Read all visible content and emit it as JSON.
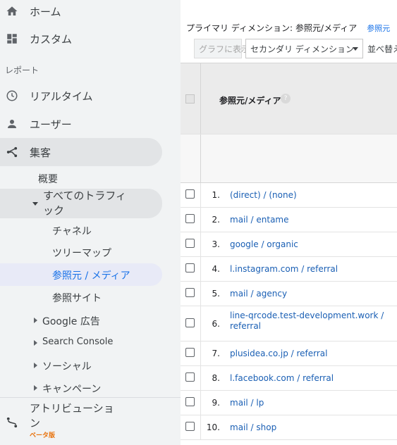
{
  "sidebar": {
    "top_items": [
      {
        "label": "ホーム",
        "icon": "home-icon"
      },
      {
        "label": "カスタム",
        "icon": "dashboard-icon"
      }
    ],
    "section_label": "レポート",
    "report_items": [
      {
        "label": "リアルタイム",
        "icon": "clock-icon"
      },
      {
        "label": "ユーザー",
        "icon": "person-icon"
      },
      {
        "label": "集客",
        "icon": "acquisition-icon"
      }
    ],
    "acquisition_children": {
      "overview": "概要",
      "all_traffic": "すべてのトラフィック",
      "all_traffic_children": [
        "チャネル",
        "ツリーマップ",
        "参照元 / メディア",
        "参照サイト"
      ],
      "collapsed": [
        "Google 広告",
        "Search Console",
        "ソーシャル",
        "キャンペーン"
      ]
    },
    "attribution": {
      "label": "アトリビューション",
      "badge": "ベータ版",
      "icon": "attribution-icon"
    },
    "colors": {
      "background": "#f1f3f4",
      "selected": "#e8eaf7",
      "badge": "#e8710a"
    }
  },
  "toolbar": {
    "primary_dimension_label": "プライマリ ディメンション:",
    "primary_dimension_value": "参照元/メディア",
    "alt_dimension_link": "参照元",
    "more_indicator": ">",
    "plot_rows_button": "グラフに表示",
    "secondary_dimension_select": "セカンダリ ディメンション",
    "sort_label": "並べ替え"
  },
  "table": {
    "column_header": "参照元/メディア",
    "help_icon": "?",
    "rows": [
      {
        "num": "1.",
        "source": "(direct) / (none)"
      },
      {
        "num": "2.",
        "source": "mail / entame"
      },
      {
        "num": "3.",
        "source": "google / organic"
      },
      {
        "num": "4.",
        "source": "l.instagram.com / referral"
      },
      {
        "num": "5.",
        "source": "mail / agency"
      },
      {
        "num": "6.",
        "source": "line-qrcode.test-development.work / referral"
      },
      {
        "num": "7.",
        "source": "plusidea.co.jp / referral"
      },
      {
        "num": "8.",
        "source": "l.facebook.com / referral"
      },
      {
        "num": "9.",
        "source": "mail / lp"
      },
      {
        "num": "10.",
        "source": "mail / shop"
      }
    ],
    "colors": {
      "link": "#1a5fb4",
      "header_bg": "#ebebeb"
    }
  }
}
